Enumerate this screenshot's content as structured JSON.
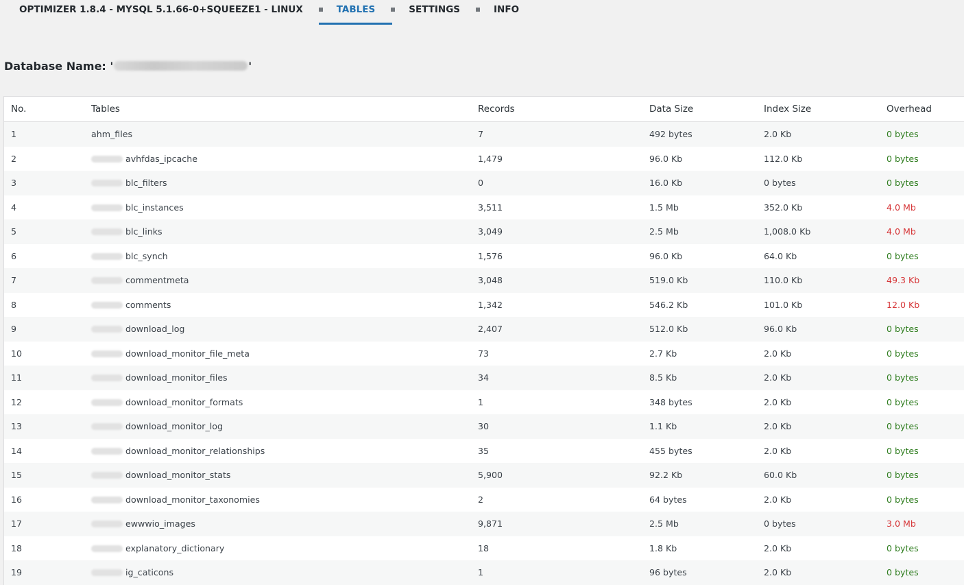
{
  "nav": {
    "title": "OPTIMIZER 1.8.4 - MYSQL 5.1.66-0+SQUEEZE1 - LINUX",
    "tabs": [
      {
        "label": "TABLES",
        "active": true
      },
      {
        "label": "SETTINGS",
        "active": false
      },
      {
        "label": "INFO",
        "active": false
      }
    ],
    "colors": {
      "accent": "#2271b1",
      "separator": "#72777c"
    }
  },
  "database": {
    "label": "Database Name: '",
    "label_close": "'"
  },
  "table": {
    "headers": [
      "No.",
      "Tables",
      "Records",
      "Data Size",
      "Index Size",
      "Overhead"
    ],
    "rows": [
      {
        "no": "1",
        "name": "ahm_files",
        "prefixed": false,
        "records": "7",
        "data": "492 bytes",
        "index": "2.0 Kb",
        "overhead": "0 bytes",
        "status": "ok"
      },
      {
        "no": "2",
        "name": "avhfdas_ipcache",
        "prefixed": true,
        "records": "1,479",
        "data": "96.0 Kb",
        "index": "112.0 Kb",
        "overhead": "0 bytes",
        "status": "ok"
      },
      {
        "no": "3",
        "name": "blc_filters",
        "prefixed": true,
        "records": "0",
        "data": "16.0 Kb",
        "index": "0 bytes",
        "overhead": "0 bytes",
        "status": "ok"
      },
      {
        "no": "4",
        "name": "blc_instances",
        "prefixed": true,
        "records": "3,511",
        "data": "1.5 Mb",
        "index": "352.0 Kb",
        "overhead": "4.0 Mb",
        "status": "bad"
      },
      {
        "no": "5",
        "name": "blc_links",
        "prefixed": true,
        "records": "3,049",
        "data": "2.5 Mb",
        "index": "1,008.0 Kb",
        "overhead": "4.0 Mb",
        "status": "bad"
      },
      {
        "no": "6",
        "name": "blc_synch",
        "prefixed": true,
        "records": "1,576",
        "data": "96.0 Kb",
        "index": "64.0 Kb",
        "overhead": "0 bytes",
        "status": "ok"
      },
      {
        "no": "7",
        "name": "commentmeta",
        "prefixed": true,
        "records": "3,048",
        "data": "519.0 Kb",
        "index": "110.0 Kb",
        "overhead": "49.3 Kb",
        "status": "bad"
      },
      {
        "no": "8",
        "name": "comments",
        "prefixed": true,
        "records": "1,342",
        "data": "546.2 Kb",
        "index": "101.0 Kb",
        "overhead": "12.0 Kb",
        "status": "bad"
      },
      {
        "no": "9",
        "name": "download_log",
        "prefixed": true,
        "records": "2,407",
        "data": "512.0 Kb",
        "index": "96.0 Kb",
        "overhead": "0 bytes",
        "status": "ok"
      },
      {
        "no": "10",
        "name": "download_monitor_file_meta",
        "prefixed": true,
        "records": "73",
        "data": "2.7 Kb",
        "index": "2.0 Kb",
        "overhead": "0 bytes",
        "status": "ok"
      },
      {
        "no": "11",
        "name": "download_monitor_files",
        "prefixed": true,
        "records": "34",
        "data": "8.5 Kb",
        "index": "2.0 Kb",
        "overhead": "0 bytes",
        "status": "ok"
      },
      {
        "no": "12",
        "name": "download_monitor_formats",
        "prefixed": true,
        "records": "1",
        "data": "348 bytes",
        "index": "2.0 Kb",
        "overhead": "0 bytes",
        "status": "ok"
      },
      {
        "no": "13",
        "name": "download_monitor_log",
        "prefixed": true,
        "records": "30",
        "data": "1.1 Kb",
        "index": "2.0 Kb",
        "overhead": "0 bytes",
        "status": "ok"
      },
      {
        "no": "14",
        "name": "download_monitor_relationships",
        "prefixed": true,
        "records": "35",
        "data": "455 bytes",
        "index": "2.0 Kb",
        "overhead": "0 bytes",
        "status": "ok"
      },
      {
        "no": "15",
        "name": "download_monitor_stats",
        "prefixed": true,
        "records": "5,900",
        "data": "92.2 Kb",
        "index": "60.0 Kb",
        "overhead": "0 bytes",
        "status": "ok"
      },
      {
        "no": "16",
        "name": "download_monitor_taxonomies",
        "prefixed": true,
        "records": "2",
        "data": "64 bytes",
        "index": "2.0 Kb",
        "overhead": "0 bytes",
        "status": "ok"
      },
      {
        "no": "17",
        "name": "ewwwio_images",
        "prefixed": true,
        "records": "9,871",
        "data": "2.5 Mb",
        "index": "0 bytes",
        "overhead": "3.0 Mb",
        "status": "bad"
      },
      {
        "no": "18",
        "name": "explanatory_dictionary",
        "prefixed": true,
        "records": "18",
        "data": "1.8 Kb",
        "index": "2.0 Kb",
        "overhead": "0 bytes",
        "status": "ok"
      },
      {
        "no": "19",
        "name": "ig_caticons",
        "prefixed": true,
        "records": "1",
        "data": "96 bytes",
        "index": "2.0 Kb",
        "overhead": "0 bytes",
        "status": "ok"
      }
    ],
    "colors": {
      "ok": "#2f7d1f",
      "bad": "#d63638"
    }
  }
}
